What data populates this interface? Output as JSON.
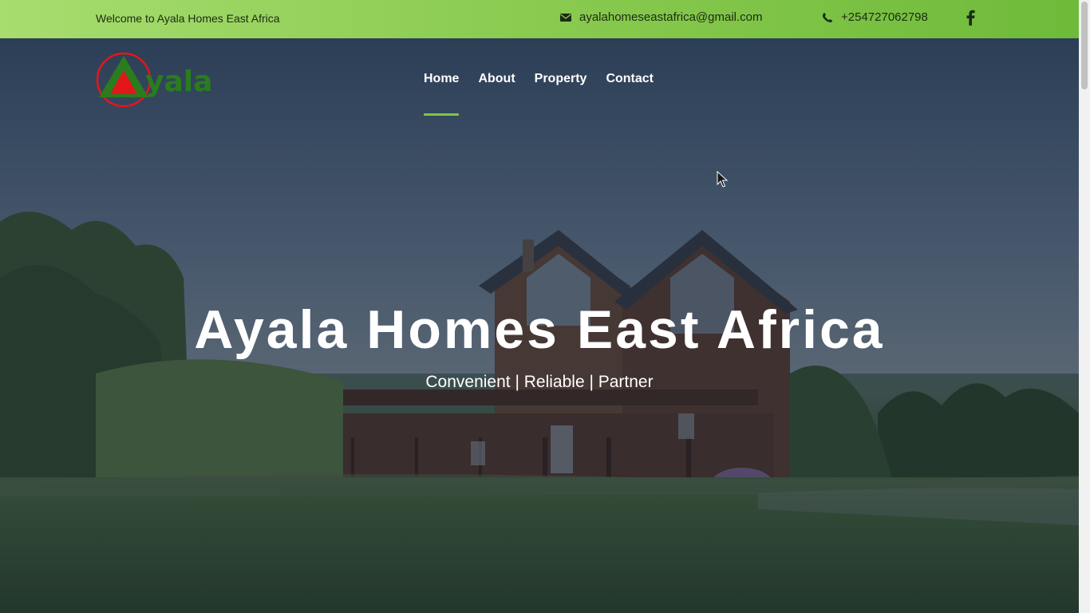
{
  "topbar": {
    "welcome": "Welcome to Ayala Homes East Africa",
    "email": "ayalahomeseastafrica@gmail.com",
    "phone": "+254727062798",
    "email_icon": "envelope-icon",
    "phone_icon": "phone-icon",
    "social_icon": "facebook-icon"
  },
  "logo": {
    "text": "yala"
  },
  "nav": {
    "items": [
      {
        "label": "Home",
        "active": true
      },
      {
        "label": "About",
        "active": false
      },
      {
        "label": "Property",
        "active": false
      },
      {
        "label": "Contact",
        "active": false
      }
    ]
  },
  "hero": {
    "title": "Ayala Homes East Africa",
    "tagline": "Convenient | Reliable | Partner"
  },
  "colors": {
    "topbar_start": "#a7dd6f",
    "topbar_end": "#6fba3a",
    "accent": "#7cc742",
    "logo_green": "#2a7d1e",
    "logo_red": "#e3161b"
  }
}
